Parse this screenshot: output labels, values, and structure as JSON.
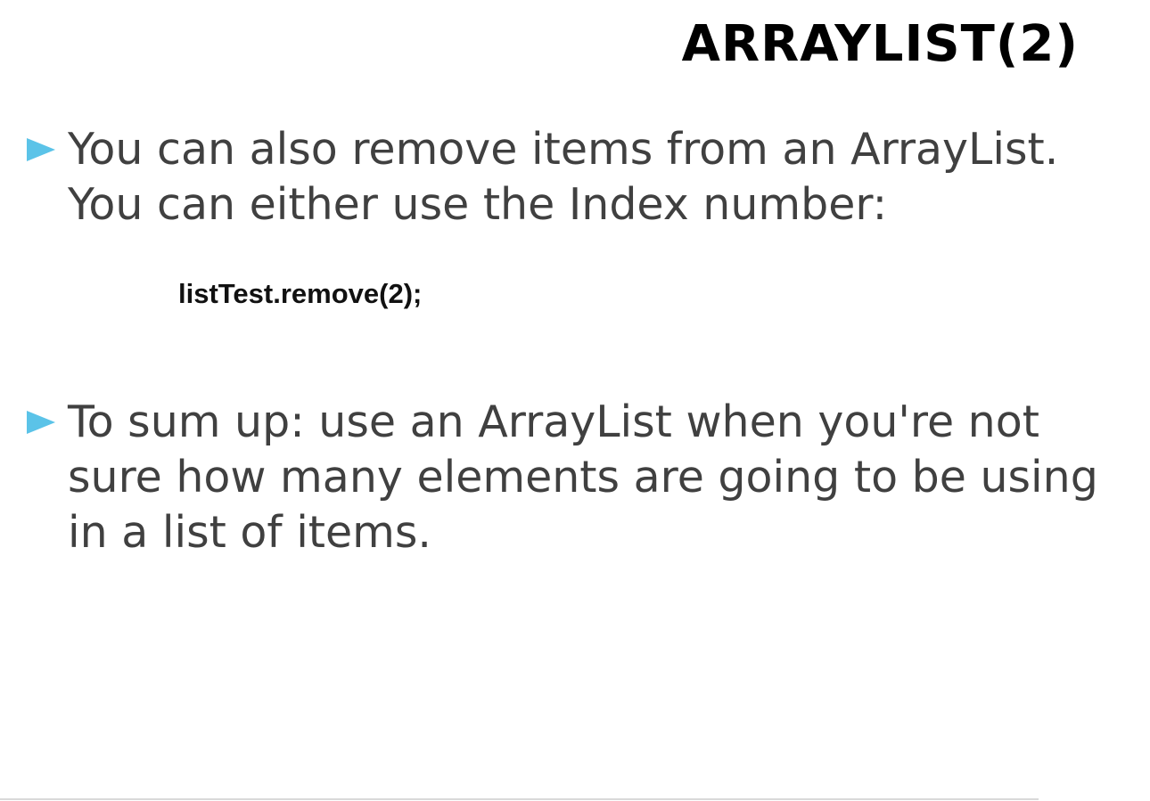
{
  "slide": {
    "title": "ARRAYLIST(2)",
    "bullets": [
      {
        "text": "You can also remove items from an ArrayList. You can either use the Index number:"
      },
      {
        "text": "To sum up: use an ArrayList when you're not sure how many elements are going to be using in a list of items."
      }
    ],
    "code_snippet": "listTest.remove(2);"
  },
  "colors": {
    "bullet_marker": "#5bc3e8",
    "body_text": "#404040",
    "title_text": "#000000"
  }
}
